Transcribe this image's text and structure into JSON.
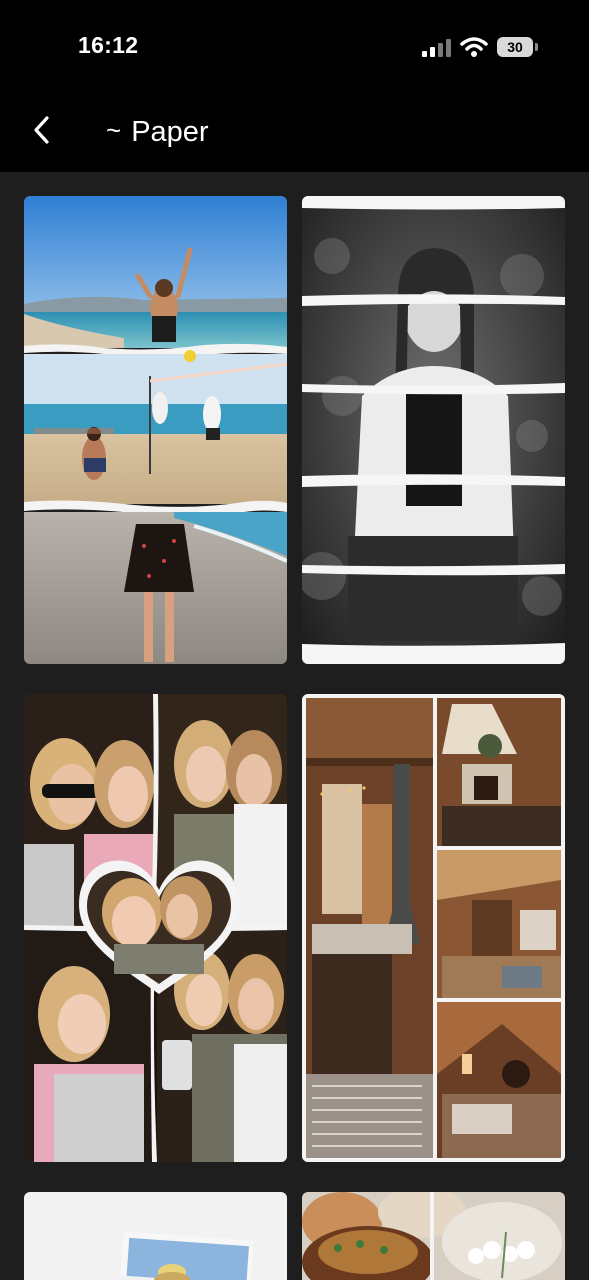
{
  "status_bar": {
    "time": "16:12",
    "battery": "30",
    "icons": [
      "signal-icon",
      "wifi-icon",
      "battery-icon"
    ]
  },
  "nav": {
    "back_icon": "chevron-left-icon",
    "tilde": "~",
    "title": "Paper"
  },
  "templates": [
    {
      "name": "template-beach-collage"
    },
    {
      "name": "template-bw-strips"
    },
    {
      "name": "template-friends-heart"
    },
    {
      "name": "template-cabin-interior"
    },
    {
      "name": "template-paper-frame"
    },
    {
      "name": "template-food"
    }
  ],
  "colors": {
    "background": "#1e1e1e",
    "bar": "#000000",
    "text": "#ffffff"
  }
}
